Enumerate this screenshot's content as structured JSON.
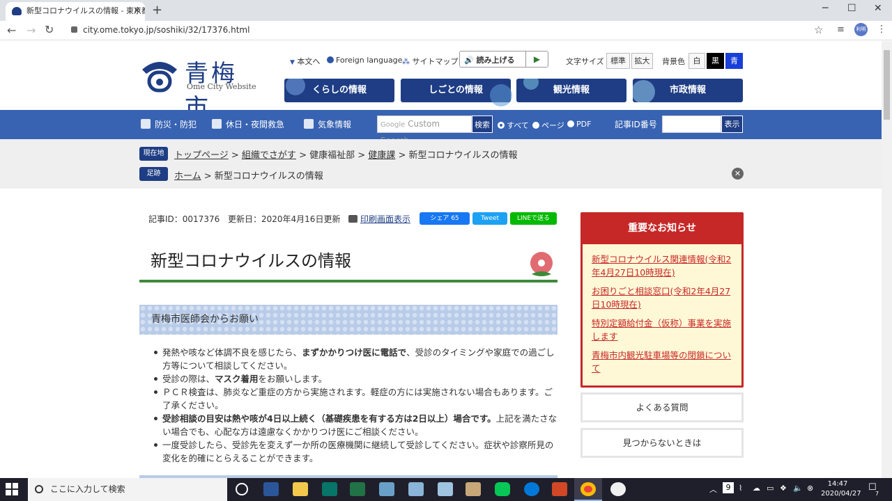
{
  "browser": {
    "tab_title": "新型コロナウイルスの情報 - 東京都青梅市",
    "url": "city.ome.tokyo.jp/soshiki/32/17376.html",
    "profile": "利明"
  },
  "header": {
    "logo_name": "青梅市",
    "logo_sub": "Ome City Website",
    "util": {
      "main_text": "本文へ",
      "foreign": "Foreign language",
      "sitemap": "サイトマップ",
      "read_aloud": "読み上げる",
      "font_size_label": "文字サイズ",
      "font_std": "標準",
      "font_large": "拡大",
      "bg_label": "背景色",
      "bg_white": "白",
      "bg_black": "黒",
      "bg_blue": "青"
    },
    "main_nav": [
      "くらしの情報",
      "しごとの情報",
      "観光情報",
      "市政情報"
    ]
  },
  "bluenav": {
    "items": [
      "防災・防犯",
      "休日・夜間救急",
      "気象情報"
    ],
    "search_placeholder": "Custom Search",
    "search_google": "Google",
    "search_button": "検索",
    "radios": [
      "すべて",
      "ページ",
      "PDF"
    ],
    "id_label": "記事ID番号",
    "id_button": "表示"
  },
  "breadcrumb": {
    "current_tag": "現在地",
    "path": [
      "トップページ",
      "組織でさがす",
      "健康福祉部",
      "健康課",
      "新型コロナウイルスの情報"
    ],
    "history_tag": "足跡",
    "history": [
      "ホーム",
      "新型コロナウイルスの情報"
    ]
  },
  "article": {
    "id": "記事ID：0017376",
    "updated": "更新日：2020年4月16日更新",
    "print": "印刷画面表示",
    "share_fb": "シェア 65",
    "share_tw": "Tweet",
    "share_line": "LINEで送る",
    "title": "新型コロナウイルスの情報",
    "section_title": "青梅市医師会からお願い",
    "bullets": [
      {
        "pre": "発熱や咳など体調不良を感じたら、",
        "bold": "まずかかりつけ医に電話で",
        "post": "、受診のタイミングや家庭での過ごし方等について相談してください。"
      },
      {
        "pre": "受診の際は、",
        "bold": "マスク着用",
        "post": "をお願いします。"
      },
      {
        "pre": "ＰＣＲ検査は、肺炎など重症の方から実施されます。軽症の方には実施されない場合もあります。ご了承ください。",
        "bold": "",
        "post": ""
      },
      {
        "pre": "",
        "bold": "受診相談の目安は熱や咳が4日以上続く（基礎疾患を有する方は2日以上）場合です。",
        "post": "上記を満たさない場合でも、心配な方は遠慮なくかかりつけ医にご相談ください。"
      },
      {
        "pre": "一度受診したら、受診先を変えず一か所の医療機関に継続して受診してください。症状や診察所見の変化を的確にとらえることができます。",
        "bold": "",
        "post": ""
      }
    ]
  },
  "sidebar": {
    "notice_title": "重要なお知らせ",
    "notices": [
      "新型コロナウイルス関連情報(令和2年4月27日10時現在)",
      "お困りごと相談窓口(令和2年4月27日10時現在)",
      "特別定額給付金（仮称）事業を実施します",
      "青梅市内観光駐車場等の閉鎖について"
    ],
    "faq": "よくある質問",
    "notfound": "見つからないときは"
  },
  "taskbar": {
    "search_placeholder": "ここに入力して検索",
    "badge": "9",
    "time": "14:47",
    "date": "2020/04/27",
    "notif_count": "7"
  }
}
